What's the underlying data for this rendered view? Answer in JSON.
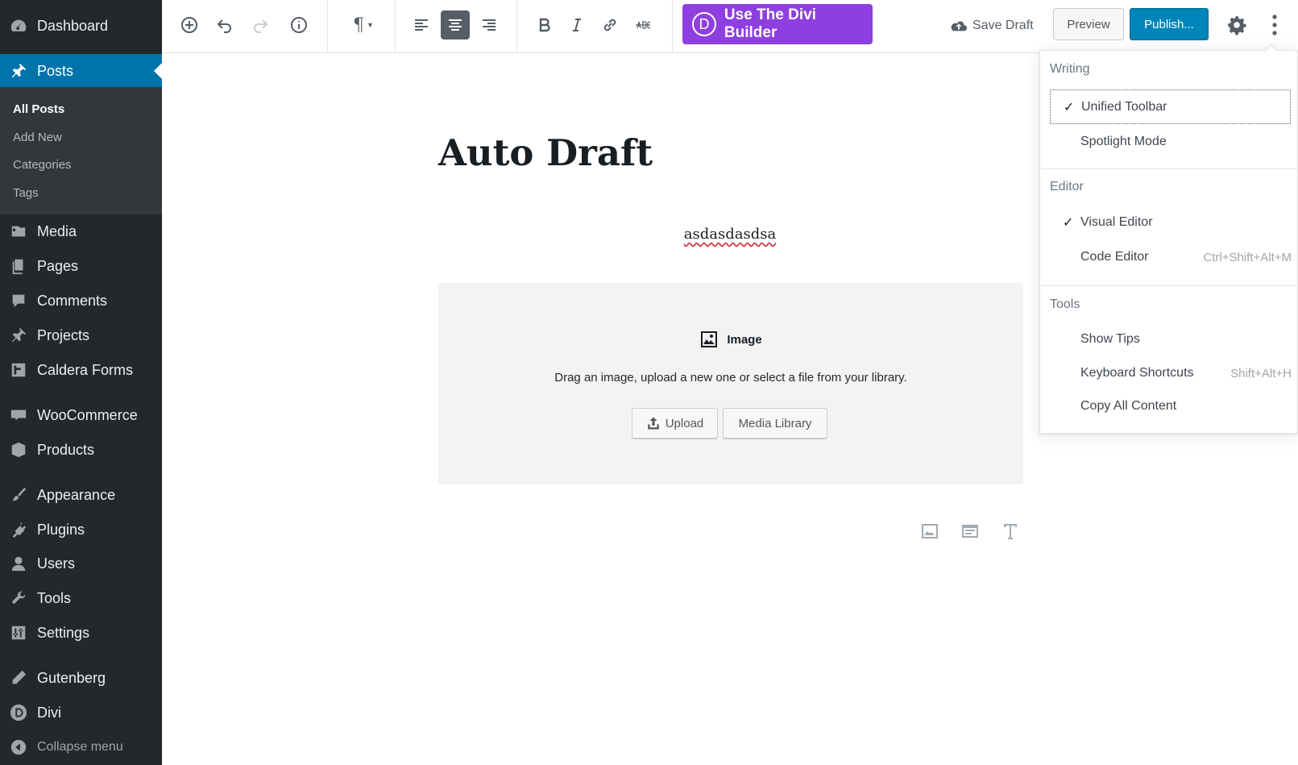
{
  "sidebar": {
    "items": [
      {
        "label": "Dashboard",
        "icon": "dashboard-icon"
      },
      {
        "label": "Posts",
        "icon": "pushpin-icon"
      },
      {
        "label": "Media",
        "icon": "media-icon"
      },
      {
        "label": "Pages",
        "icon": "pages-icon"
      },
      {
        "label": "Comments",
        "icon": "comment-icon"
      },
      {
        "label": "Projects",
        "icon": "pushpin-icon"
      },
      {
        "label": "Caldera Forms",
        "icon": "caldera-icon"
      },
      {
        "label": "WooCommerce",
        "icon": "woo-icon"
      },
      {
        "label": "Products",
        "icon": "box-icon"
      },
      {
        "label": "Appearance",
        "icon": "brush-icon"
      },
      {
        "label": "Plugins",
        "icon": "plug-icon"
      },
      {
        "label": "Users",
        "icon": "user-icon"
      },
      {
        "label": "Tools",
        "icon": "wrench-icon"
      },
      {
        "label": "Settings",
        "icon": "sliders-icon"
      },
      {
        "label": "Gutenberg",
        "icon": "pencil-icon"
      },
      {
        "label": "Divi",
        "icon": "divi-icon"
      },
      {
        "label": "Collapse menu",
        "icon": "collapse-icon"
      }
    ],
    "submenu": [
      "All Posts",
      "Add New",
      "Categories",
      "Tags"
    ]
  },
  "toolbar": {
    "divi_label": "Use The Divi Builder",
    "divi_letter": "D",
    "paragraph_glyph": "¶",
    "save_draft": "Save Draft",
    "preview": "Preview",
    "publish": "Publish..."
  },
  "editor": {
    "title": "Auto Draft",
    "paragraph": "asdasdasdsa",
    "image_block": {
      "label": "Image",
      "instructions": "Drag an image, upload a new one or select a file from your library.",
      "upload": "Upload",
      "media_library": "Media Library"
    }
  },
  "menu": {
    "writing_heading": "Writing",
    "unified_toolbar": "Unified Toolbar",
    "spotlight_mode": "Spotlight Mode",
    "editor_heading": "Editor",
    "visual_editor": "Visual Editor",
    "code_editor": "Code Editor",
    "code_editor_shortcut": "Ctrl+Shift+Alt+M",
    "tools_heading": "Tools",
    "show_tips": "Show Tips",
    "keyboard_shortcuts": "Keyboard Shortcuts",
    "keyboard_shortcuts_shortcut": "Shift+Alt+H",
    "copy_all": "Copy All Content",
    "check": "✓"
  },
  "colors": {
    "sidebar_bg": "#23282d",
    "accent": "#0073aa",
    "divi": "#8f3ee0",
    "publish": "#0085ba"
  }
}
